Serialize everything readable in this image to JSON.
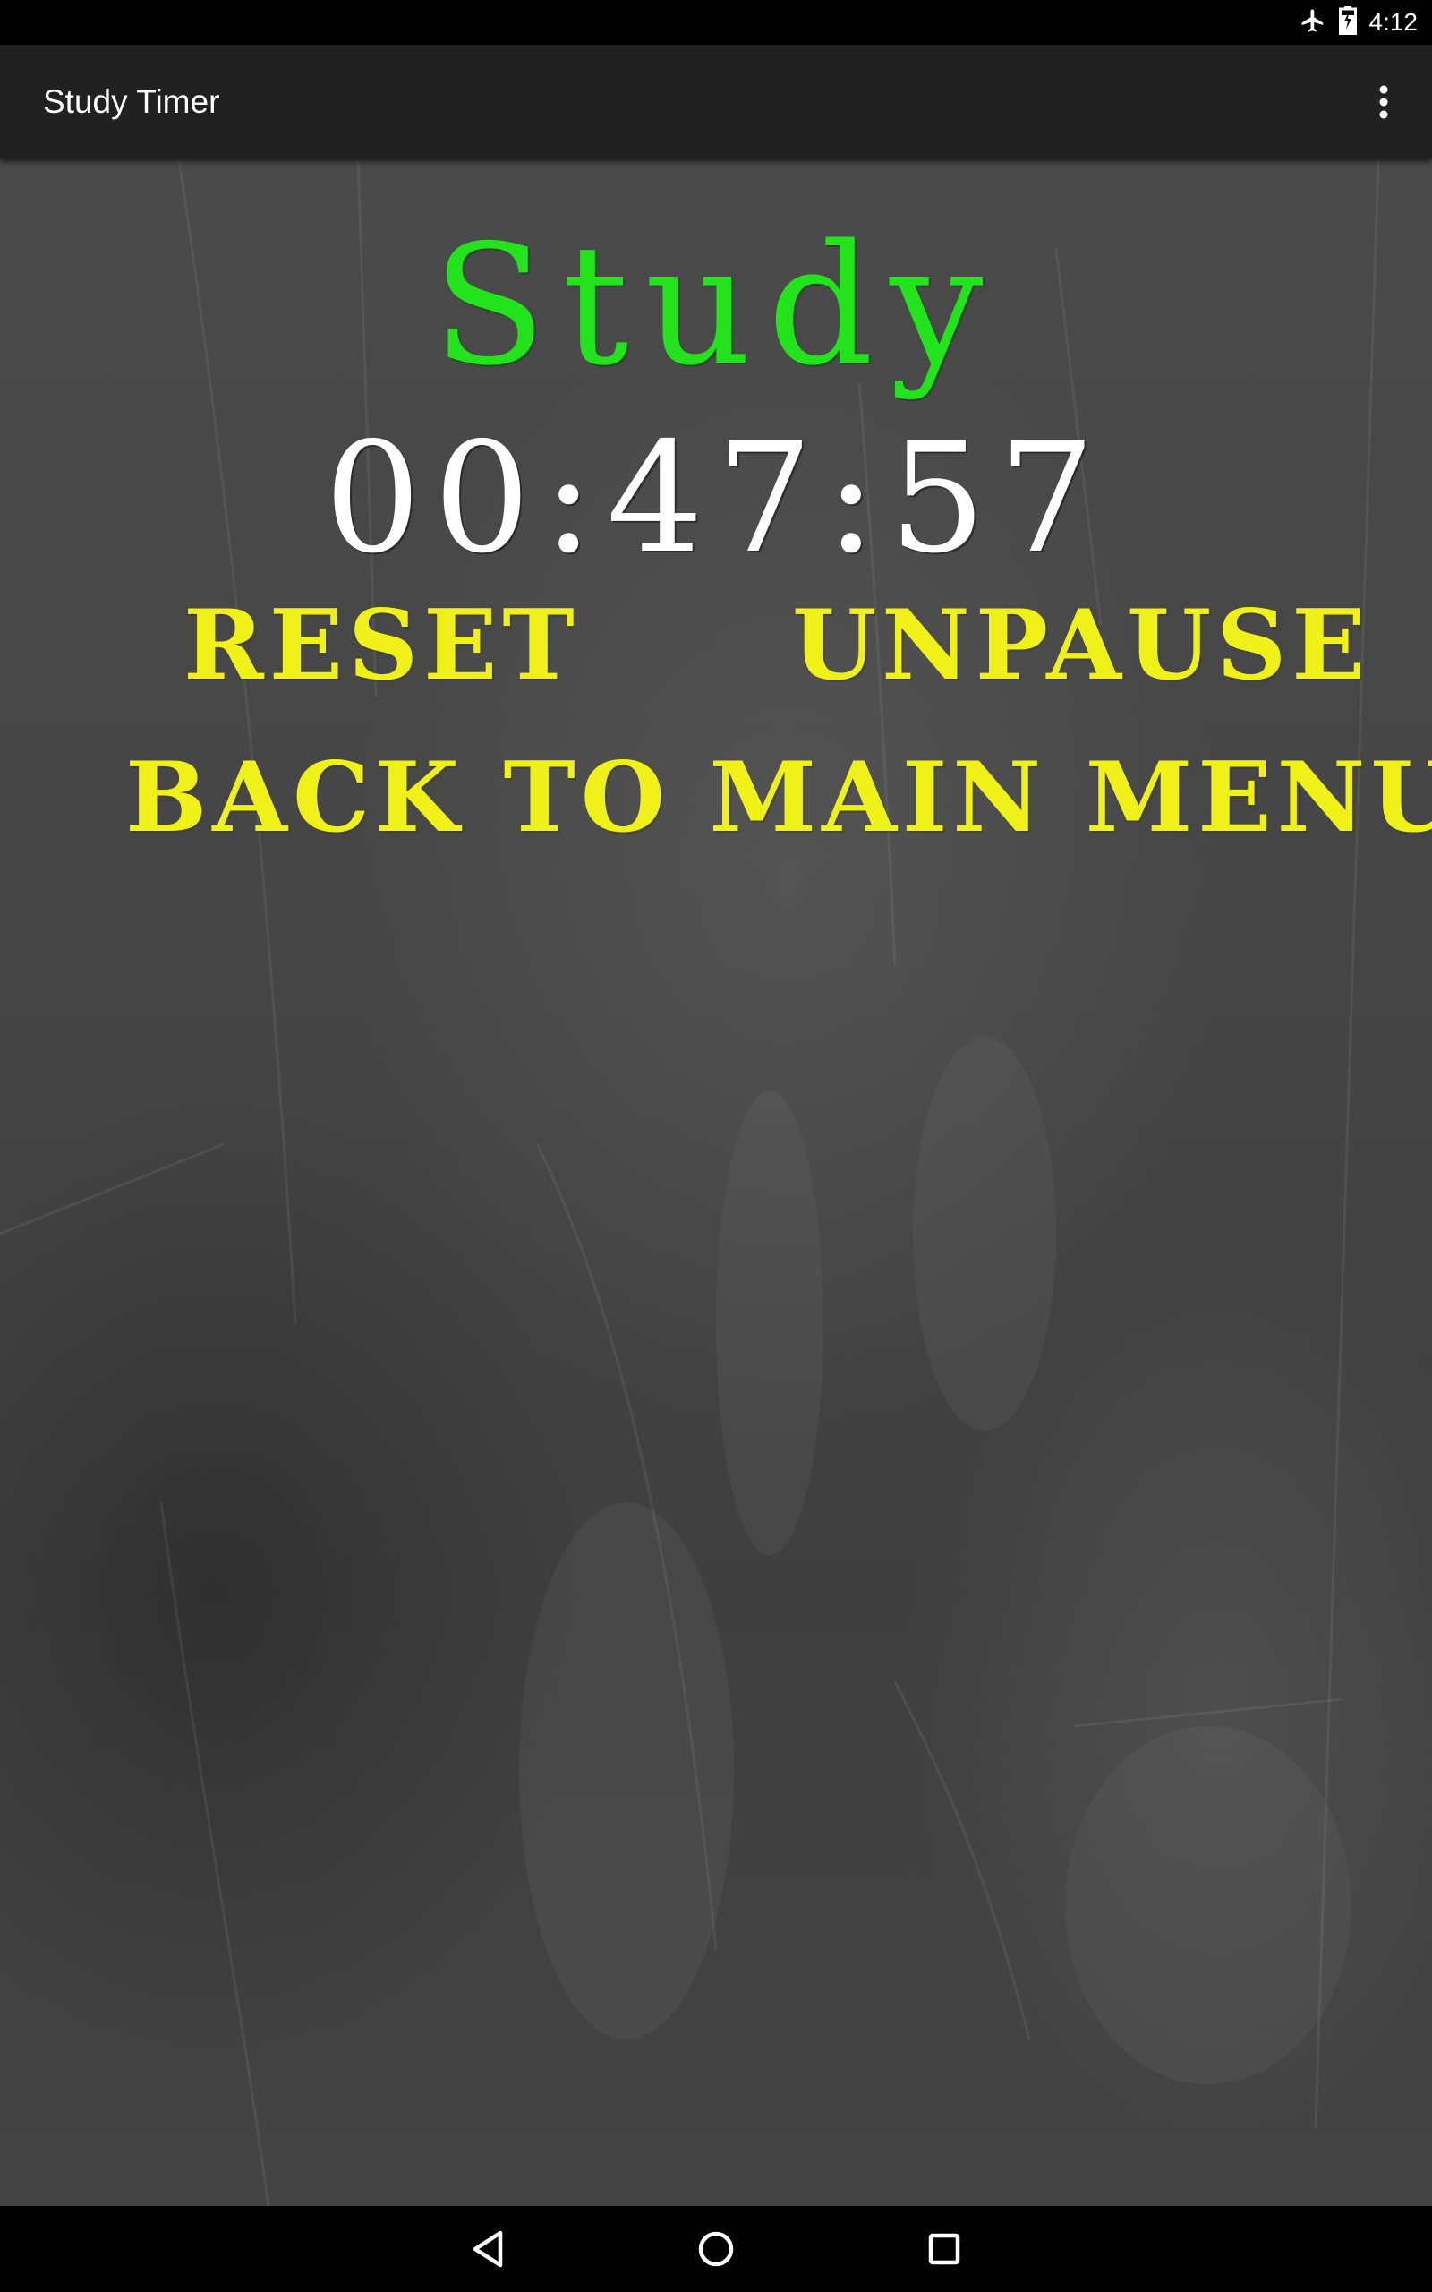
{
  "status_bar": {
    "time": "4:12",
    "icons": [
      "airplane-mode-icon",
      "battery-icon"
    ]
  },
  "app_bar": {
    "title": "Study Timer",
    "overflow_icon": "more-vert-icon"
  },
  "main": {
    "mode_label": "Study",
    "timer_value": "00:47:57",
    "reset_label": "RESET",
    "unpause_label": "UNPAUSE",
    "back_label": "BACK TO MAIN MENU"
  },
  "nav_bar": {
    "icons": [
      "back-icon",
      "home-icon",
      "recents-icon"
    ]
  },
  "colors": {
    "mode_label": "#22e31c",
    "timer": "#ffffff",
    "buttons": "#f1f11a",
    "app_bar": "#212121",
    "chalkboard": "#454545"
  }
}
